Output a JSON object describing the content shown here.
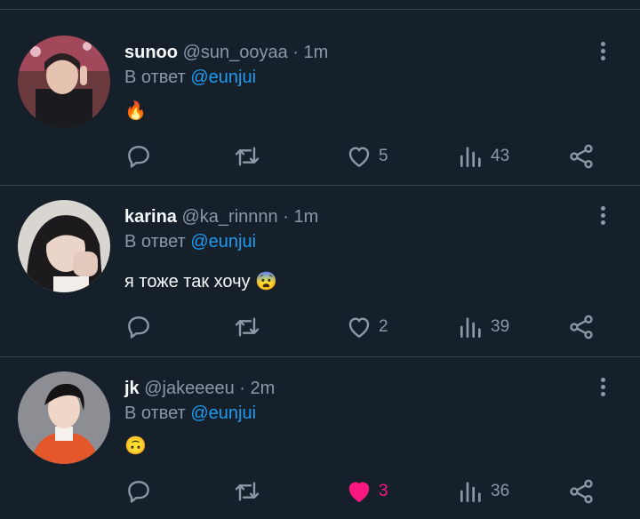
{
  "reply_prefix": "В ответ",
  "icons": {
    "reply": "reply-icon",
    "retweet": "retweet-icon",
    "like": "heart-icon",
    "views": "views-icon",
    "share": "share-icon",
    "more": "more-vertical-icon"
  },
  "colors": {
    "background": "#15202b",
    "secondary_text": "#8b98a5",
    "mention": "#1d9bf0",
    "like_active": "#f91880",
    "divider": "#38444d"
  },
  "tweets": [
    {
      "name": "sunoo",
      "handle": "@sun_ooyaa",
      "dot": "·",
      "time": "1m",
      "reply_to": "@eunjui",
      "text": "🔥",
      "likes": "5",
      "views": "43",
      "liked": false
    },
    {
      "name": "karina",
      "handle": "@ka_rinnnn",
      "dot": "·",
      "time": "1m",
      "reply_to": "@eunjui",
      "text": "я тоже так хочу 😨",
      "likes": "2",
      "views": "39",
      "liked": false
    },
    {
      "name": "jk",
      "handle": "@jakeeeeu",
      "dot": "·",
      "time": "2m",
      "reply_to": "@eunjui",
      "text": "🙃",
      "likes": "3",
      "views": "36",
      "liked": true
    }
  ]
}
